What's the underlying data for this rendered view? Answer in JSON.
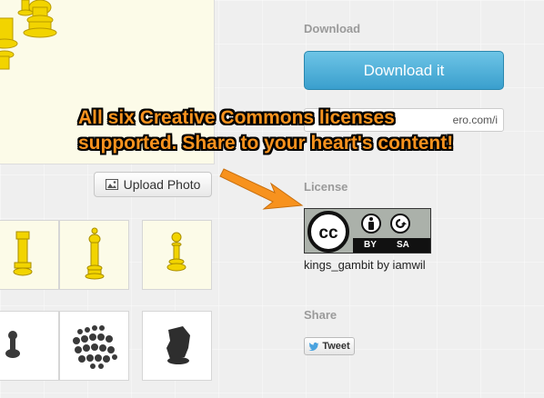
{
  "viewer": {
    "upload_label": "Upload Photo"
  },
  "download": {
    "section_title": "Download",
    "button_label": "Download it",
    "embed_value": "ero.com/i"
  },
  "license": {
    "section_title": "License",
    "badge_cc": "cc",
    "badge_by": "BY",
    "badge_sa": "SA",
    "caption": "kings_gambit by iamwil"
  },
  "share": {
    "section_title": "Share",
    "tweet_label": "Tweet"
  },
  "annotation": {
    "line1": "All six Creative Commons licenses",
    "line2": "supported. Share to your heart's content!"
  },
  "colors": {
    "accent": "#3a9fcd",
    "annotation": "#f7921e",
    "piece_yellow": "#f5d800",
    "piece_dark": "#333333"
  },
  "icons": [
    "photo-icon",
    "twitter-bird-icon",
    "cc-logo-icon",
    "attribution-icon",
    "share-alike-icon",
    "arrow-pointer"
  ]
}
